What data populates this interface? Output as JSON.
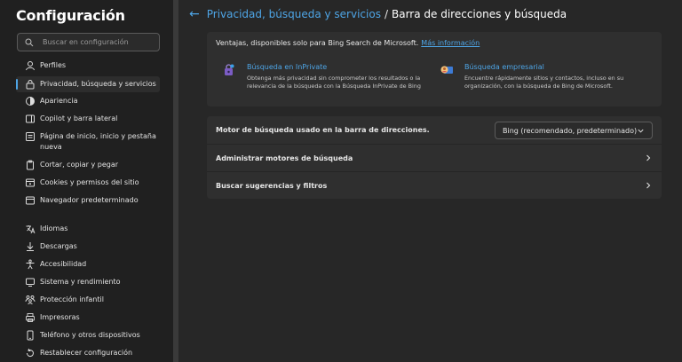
{
  "sidebar": {
    "title": "Configuración",
    "search": {
      "placeholder": "Buscar en configuración"
    },
    "items": [
      {
        "label": "Perfiles",
        "icon": "person-icon"
      },
      {
        "label": "Privacidad, búsqueda y servicios",
        "icon": "lock-icon",
        "active": true
      },
      {
        "label": "Apariencia",
        "icon": "appearance-icon"
      },
      {
        "label": "Copilot y barra lateral",
        "icon": "sidebar-icon"
      },
      {
        "label": "Página de inicio, inicio y pestaña nueva",
        "icon": "home-icon"
      },
      {
        "label": "Cortar, copiar y pegar",
        "icon": "clipboard-icon"
      },
      {
        "label": "Cookies y permisos del sitio",
        "icon": "cookie-icon"
      },
      {
        "label": "Navegador predeterminado",
        "icon": "browser-icon"
      },
      {
        "label": "Idiomas",
        "icon": "language-icon"
      },
      {
        "label": "Descargas",
        "icon": "download-icon"
      },
      {
        "label": "Accesibilidad",
        "icon": "accessibility-icon"
      },
      {
        "label": "Sistema y rendimiento",
        "icon": "system-icon"
      },
      {
        "label": "Protección infantil",
        "icon": "family-icon"
      },
      {
        "label": "Impresoras",
        "icon": "printer-icon"
      },
      {
        "label": "Teléfono y otros dispositivos",
        "icon": "phone-icon"
      },
      {
        "label": "Restablecer configuración",
        "icon": "reset-icon"
      }
    ]
  },
  "breadcrumb": {
    "parent": "Privacidad, búsqueda y servicios",
    "separator": "/",
    "current": "Barra de direcciones y búsqueda"
  },
  "promo": {
    "heading": "Ventajas, disponibles solo para Bing Search de Microsoft.",
    "link": "Más información",
    "features": [
      {
        "title": "Búsqueda en InPrivate",
        "desc_line1": "Obtenga más privacidad sin comprometer los resultados o la",
        "desc_line2": "relevancia de la búsqueda con la Búsqueda InPrivate de Bing"
      },
      {
        "title": "Búsqueda empresarial",
        "desc_line1": "Encuentre rápidamente sitios y contactos, incluso en su",
        "desc_line2": "organización, con la búsqueda de Bing de Microsoft."
      }
    ]
  },
  "settings": {
    "engine_label": "Motor de búsqueda usado en la barra de direcciones.",
    "engine_value": "Bing (recomendado, predeterminado)",
    "manage_label": "Administrar motores de búsqueda",
    "suggestions_label": "Buscar sugerencias y filtros"
  },
  "colors": {
    "accent": "#4ea5e6",
    "background": "#272727",
    "sidebar": "#202020",
    "card": "#2f2f2f"
  }
}
